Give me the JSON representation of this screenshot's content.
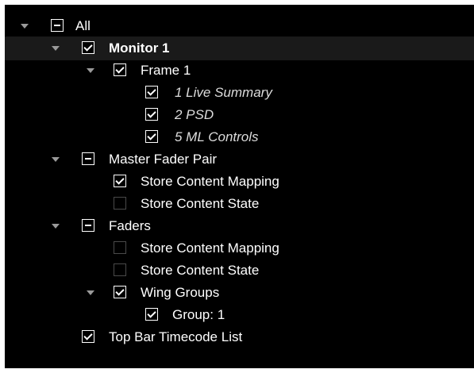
{
  "tree": {
    "all": {
      "label": "All",
      "state": "partial"
    },
    "monitor1": {
      "label": "Monitor 1",
      "state": "checked"
    },
    "frame1": {
      "label": "Frame 1",
      "state": "checked"
    },
    "live_summary": {
      "label": "1 Live Summary",
      "state": "checked"
    },
    "psd": {
      "label": "2 PSD",
      "state": "checked"
    },
    "ml_controls": {
      "label": "5 ML Controls",
      "state": "checked"
    },
    "master_fader_pair": {
      "label": "Master Fader Pair",
      "state": "partial"
    },
    "mfp_store_mapping": {
      "label": "Store Content Mapping",
      "state": "checked"
    },
    "mfp_store_state": {
      "label": "Store Content State",
      "state": "unchecked"
    },
    "faders": {
      "label": "Faders",
      "state": "partial"
    },
    "faders_store_mapping": {
      "label": "Store Content Mapping",
      "state": "unchecked"
    },
    "faders_store_state": {
      "label": "Store Content State",
      "state": "unchecked"
    },
    "wing_groups": {
      "label": "Wing Groups",
      "state": "checked"
    },
    "group1": {
      "label": "Group: 1",
      "state": "checked"
    },
    "top_bar_timecode": {
      "label": "Top Bar Timecode List",
      "state": "checked"
    }
  }
}
